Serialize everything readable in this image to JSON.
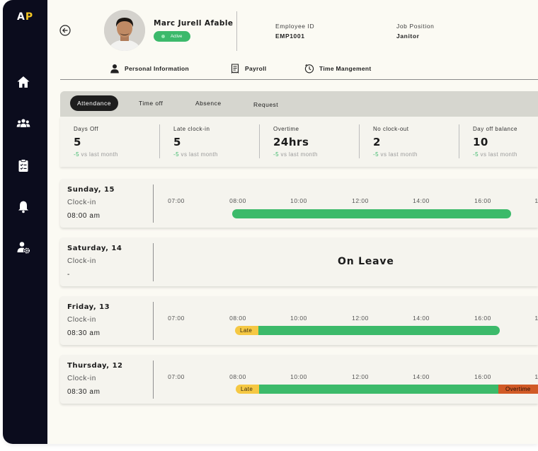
{
  "brand": {
    "logo_a": "A",
    "logo_p": "P"
  },
  "sidebar": [
    {
      "icon": "home-icon"
    },
    {
      "icon": "team-icon"
    },
    {
      "icon": "clipboard-icon"
    },
    {
      "icon": "bell-icon"
    },
    {
      "icon": "user-settings-icon"
    }
  ],
  "employee": {
    "name": "Marc Jurell Afable",
    "status": "Active",
    "id_label": "Employee ID",
    "id_value": "EMP1001",
    "position_label": "Job Position",
    "position_value": "Janitor"
  },
  "main_tabs": [
    {
      "label": "Personal Information",
      "icon": "person-icon"
    },
    {
      "label": "Payroll",
      "icon": "receipt-icon"
    },
    {
      "label": "Time Mangement",
      "icon": "clock-icon"
    }
  ],
  "sub_tabs": [
    {
      "label": "Attendance",
      "active": true
    },
    {
      "label": "Time off",
      "active": false
    },
    {
      "label": "Absence",
      "active": false
    },
    {
      "label": "Request",
      "active": false
    }
  ],
  "stats": [
    {
      "label": "Days Off",
      "value": "5",
      "delta": "-5",
      "delta_text": " vs last month"
    },
    {
      "label": "Late clock-in",
      "value": "5",
      "delta": "-5",
      "delta_text": " vs last month"
    },
    {
      "label": "Overtime",
      "value": "24hrs",
      "delta": "-5",
      "delta_text": " vs last month"
    },
    {
      "label": "No clock-out",
      "value": "2",
      "delta": "-5",
      "delta_text": " vs last month"
    },
    {
      "label": "Day off balance",
      "value": "10",
      "delta": "-5",
      "delta_text": " vs last month"
    }
  ],
  "timeline_ticks": [
    "07:00",
    "08:00",
    "10:00",
    "12:00",
    "14:00",
    "16:00",
    "1"
  ],
  "days": [
    {
      "date": "Sunday, 15",
      "clock_label": "Clock-in",
      "clock_time": "08:00 am"
    },
    {
      "date": "Saturday, 14",
      "clock_label": "Clock-in",
      "clock_time": "-",
      "status": "On Leave"
    },
    {
      "date": "Friday, 13",
      "clock_label": "Clock-in",
      "clock_time": "08:30 am",
      "late_label": "Late"
    },
    {
      "date": "Thursday, 12",
      "clock_label": "Clock-in",
      "clock_time": "08:30 am",
      "late_label": "Late",
      "overtime_label": "Overtime"
    }
  ],
  "colors": {
    "sidebar": "#0b0c1d",
    "accent_green": "#3cba6a",
    "late_yellow": "#f5c843",
    "overtime_orange": "#d15a26",
    "logo_yellow": "#f4c623"
  }
}
